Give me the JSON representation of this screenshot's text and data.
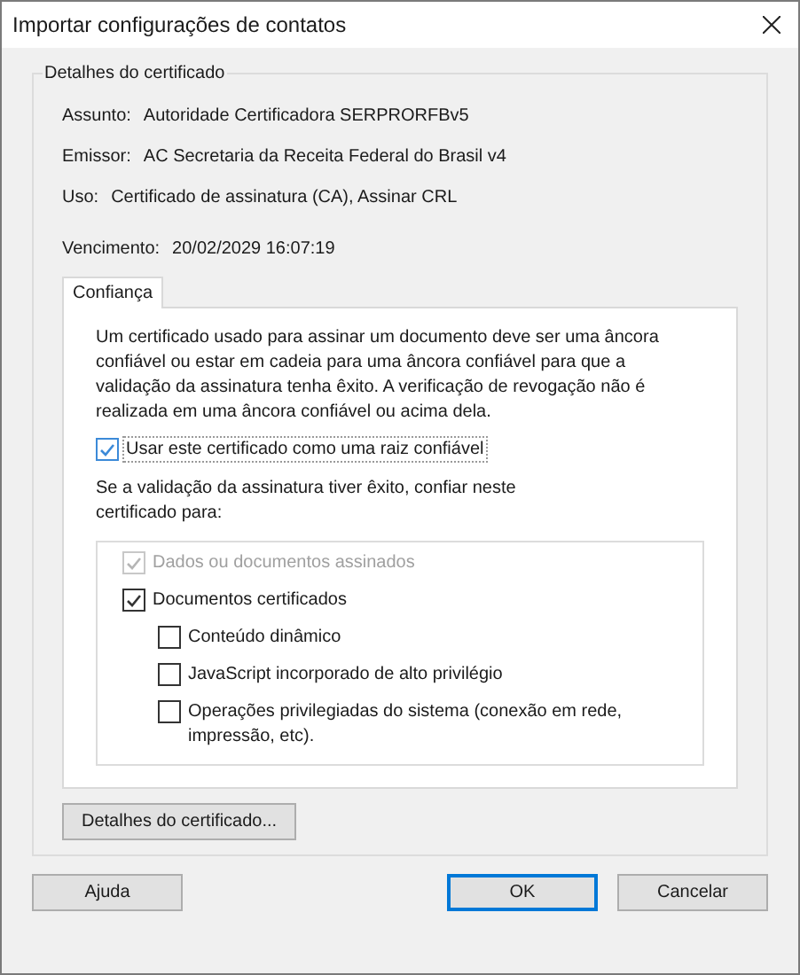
{
  "window": {
    "title": "Importar configurações de contatos"
  },
  "group": {
    "title": "Detalhes do certificado",
    "fields": [
      {
        "label": "Assunto:",
        "value": "Autoridade Certificadora SERPRORFBv5"
      },
      {
        "label": "Emissor:",
        "value": "AC Secretaria da Receita Federal do Brasil v4"
      },
      {
        "label": "Uso:",
        "value": "Certificado de assinatura (CA), Assinar CRL"
      },
      {
        "label": "Vencimento:",
        "value": "20/02/2029 16:07:19"
      }
    ],
    "tabs": [
      {
        "label": "Confiança",
        "selected": true
      }
    ],
    "description": "Um certificado usado para assinar um documento deve ser uma âncora confiável ou estar em cadeia para uma âncora confiável para que a validação da assinatura tenha êxito. A verificação de revogação não é realizada em uma âncora confiável ou acima dela.",
    "root_checkbox": {
      "label": "Usar este certificado como uma raiz confiável",
      "checked": true
    },
    "trust_prompt": "Se a validação da assinatura tiver êxito, confiar neste certificado para:",
    "options": [
      {
        "label": "Dados ou documentos assinados",
        "checked": true,
        "disabled": true
      },
      {
        "label": "Documentos certificados",
        "checked": true,
        "disabled": false,
        "children": [
          {
            "label": "Conteúdo dinâmico",
            "checked": false,
            "disabled": false
          },
          {
            "label": "JavaScript incorporado de alto privilégio",
            "checked": false,
            "disabled": false
          },
          {
            "label": "Operações privilegiadas do sistema (conexão em rede, impressão, etc).",
            "checked": false,
            "disabled": false
          }
        ]
      }
    ],
    "details_button": "Detalhes do certificado..."
  },
  "buttons": [
    {
      "label": "Ajuda",
      "default": false
    },
    {
      "label": "OK",
      "default": true
    },
    {
      "label": "Cancelar",
      "default": false
    }
  ]
}
